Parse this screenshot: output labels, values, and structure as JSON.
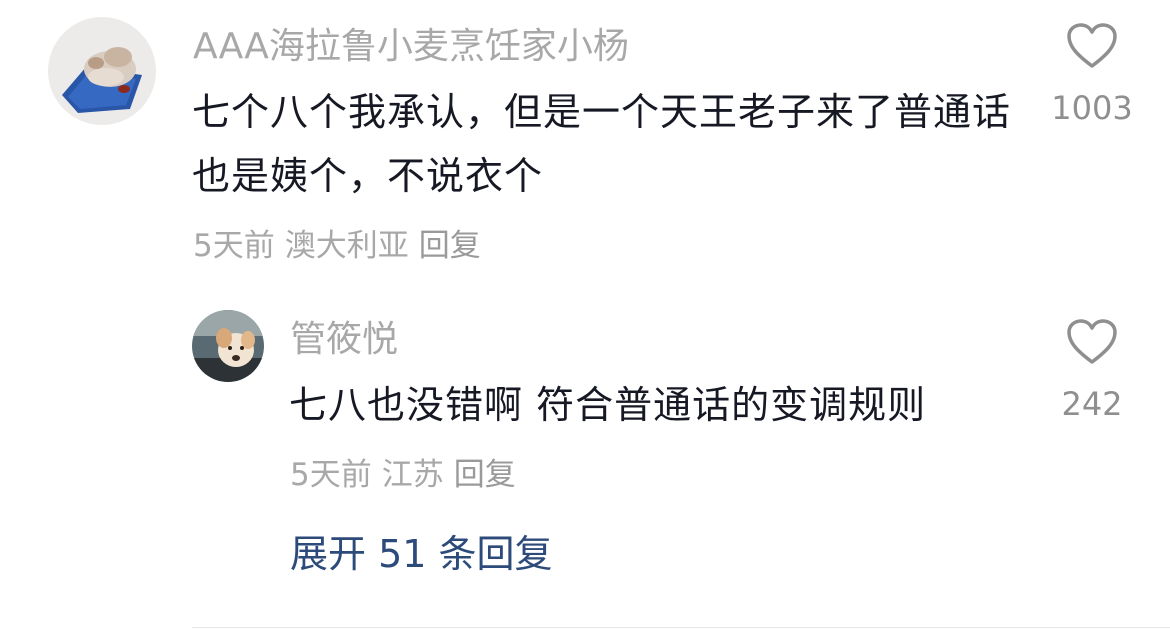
{
  "comment": {
    "author": "AAA海拉鲁小麦烹饪家小杨",
    "text": "七个八个我承认，但是一个天王老子来了普通话也是姨个，不说衣个",
    "time": "5天前",
    "location": "澳大利亚",
    "reply_label": "回复",
    "like_count": "1003",
    "avatar_icon": "food-photo-avatar",
    "like_icon": "heart-outline-icon"
  },
  "reply": {
    "author": "管筱悦",
    "text": "七八也没错啊 符合普通话的变调规则",
    "time": "5天前",
    "location": "江苏",
    "reply_label": "回复",
    "like_count": "242",
    "avatar_icon": "dog-photo-avatar",
    "like_icon": "heart-outline-icon"
  },
  "expand_label": "展开 51 条回复",
  "colors": {
    "primary_text": "#161823",
    "secondary_text": "#a8a8a8",
    "link": "#2c4a7a"
  }
}
